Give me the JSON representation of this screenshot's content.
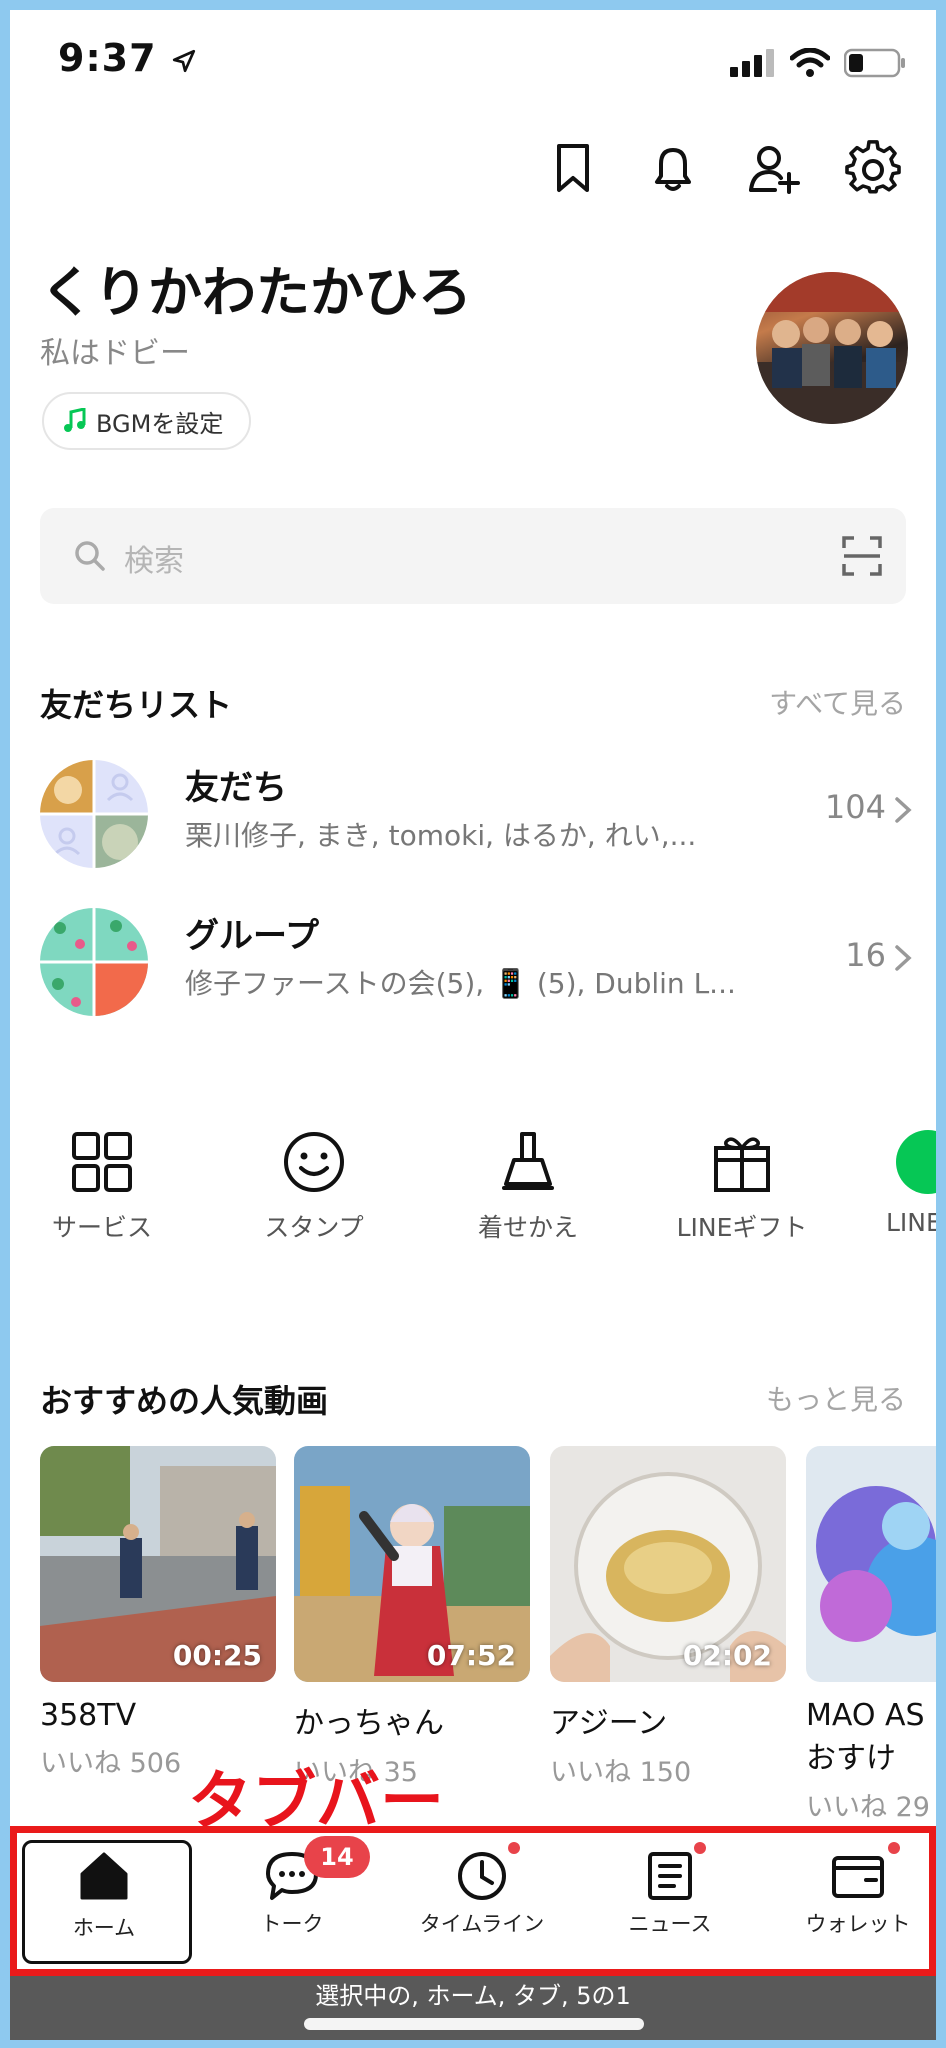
{
  "status_bar": {
    "time": "9:37"
  },
  "header_icons": [
    "bookmark-icon",
    "bell-icon",
    "add-friend-icon",
    "gear-icon"
  ],
  "profile": {
    "name": "くりかわたかひろ",
    "status_message": "私はドビー",
    "bgm_label": "BGMを設定"
  },
  "search": {
    "placeholder": "検索"
  },
  "friends_section": {
    "title": "友だちリスト",
    "see_all": "すべて見る",
    "rows": [
      {
        "title": "友だち",
        "subtitle": "栗川修子, まき, tomoki, はるか, れい,...",
        "count": "104"
      },
      {
        "title": "グループ",
        "subtitle": "修子ファーストの会(5), 📱 (5), Dublin L...",
        "count": "16"
      }
    ]
  },
  "services": [
    {
      "label": "サービス",
      "icon": "grid-icon"
    },
    {
      "label": "スタンプ",
      "icon": "smiley-icon"
    },
    {
      "label": "着せかえ",
      "icon": "brush-icon"
    },
    {
      "label": "LINEギフト",
      "icon": "gift-icon"
    },
    {
      "label": "LINE",
      "icon": "line-app-icon"
    }
  ],
  "videos_section": {
    "title": "おすすめの人気動画",
    "more": "もっと見る",
    "items": [
      {
        "duration": "00:25",
        "title": "358TV",
        "likes": "いいね 506"
      },
      {
        "duration": "07:52",
        "title": "かっちゃん",
        "likes": "いいね 35"
      },
      {
        "duration": "02:02",
        "title": "アジーン",
        "likes": "いいね 150"
      },
      {
        "duration": "",
        "title": "MAO AS",
        "subtitle": "おすけ",
        "likes": "いいね 29"
      }
    ]
  },
  "annotation": "タブバー",
  "tabs": [
    {
      "label": "ホーム",
      "icon": "home-icon",
      "selected": true
    },
    {
      "label": "トーク",
      "icon": "chat-icon",
      "badge": "14"
    },
    {
      "label": "タイムライン",
      "icon": "clock-icon",
      "dot": true
    },
    {
      "label": "ニュース",
      "icon": "news-icon",
      "dot": true
    },
    {
      "label": "ウォレット",
      "icon": "wallet-icon",
      "dot": true
    }
  ],
  "voiceover_caption": "選択中の, ホーム, タブ, 5の1",
  "colors": {
    "accent_green": "#06c755",
    "badge_red": "#e8434a",
    "highlight_red": "#ea1a1a",
    "frame_blue": "#8ec9ef"
  }
}
